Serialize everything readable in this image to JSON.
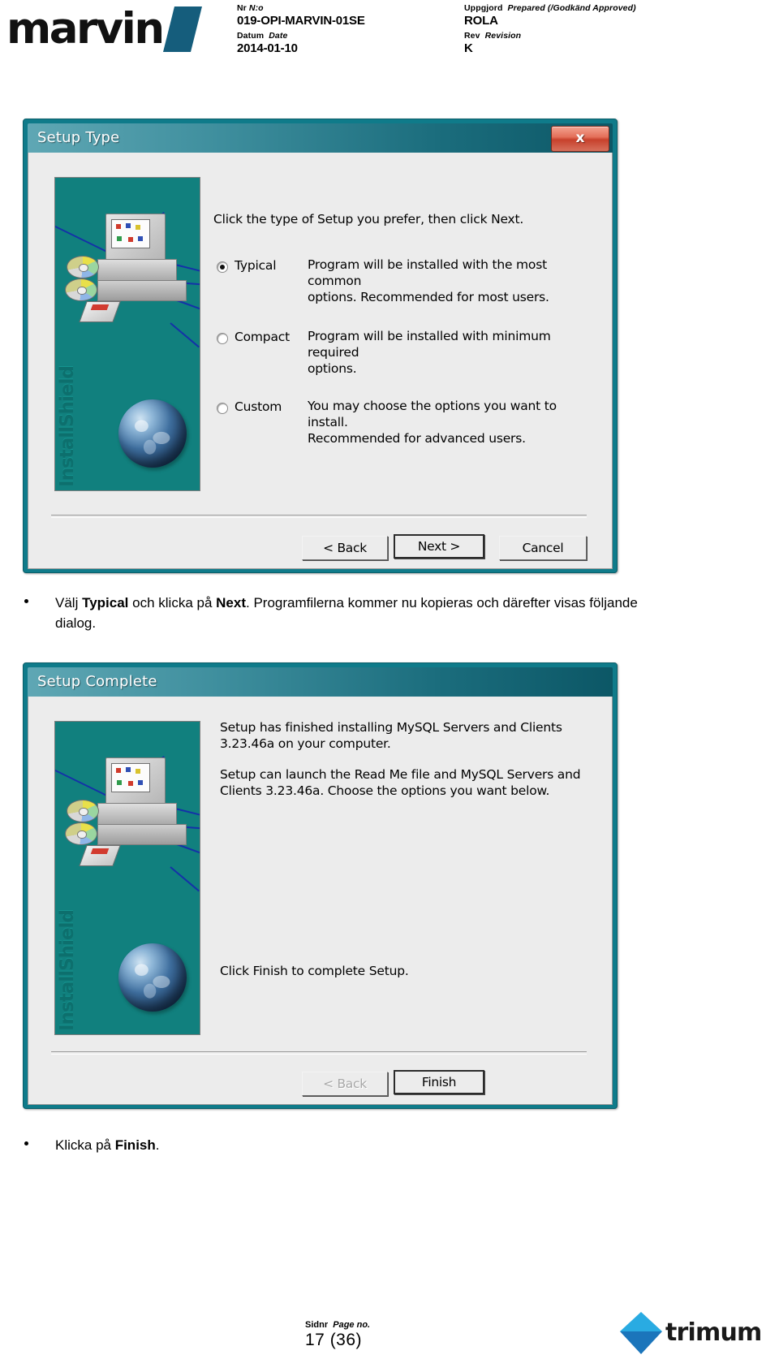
{
  "header": {
    "logo_text": "marvin",
    "fields": [
      {
        "label_sv": "Nr",
        "label_en": "N:o",
        "value": "019-OPI-MARVIN-01SE"
      },
      {
        "label_sv": "Datum",
        "label_en": "Date",
        "value": "2014-01-10"
      },
      {
        "label_sv": "Uppgjord",
        "label_en": "Prepared (/Godkänd Approved)",
        "value": "ROLA"
      },
      {
        "label_sv": "Rev",
        "label_en": "Revision",
        "value": "K"
      }
    ]
  },
  "dialog1": {
    "title": "Setup Type",
    "close_label": "x",
    "prompt": "Click the type of Setup you prefer, then click Next.",
    "options": [
      {
        "label": "Typical",
        "selected": true,
        "description": "Program will be installed with the most common\noptions.  Recommended for most users."
      },
      {
        "label": "Compact",
        "selected": false,
        "description": "Program will be installed with minimum required\noptions."
      },
      {
        "label": "Custom",
        "selected": false,
        "description": "You may choose the options you want to install.\nRecommended for advanced users."
      }
    ],
    "buttons": {
      "back": "< Back",
      "next": "Next >",
      "cancel": "Cancel"
    },
    "art_label": "InstallShield"
  },
  "note1": {
    "text_parts": [
      "Välj ",
      "Typical",
      " och klicka på ",
      "Next",
      ".  Programfilerna kommer nu kopieras och därefter visas följande dialog."
    ]
  },
  "dialog2": {
    "title": "Setup Complete",
    "paragraph1": "Setup has finished installing MySQL Servers and Clients\n3.23.46a on your computer.",
    "paragraph2": "Setup can launch the Read Me file and MySQL Servers and\nClients 3.23.46a.  Choose the options you want below.",
    "paragraph3": "Click Finish to complete Setup.",
    "buttons": {
      "back": "< Back",
      "finish": "Finish"
    },
    "art_label": "InstallShield"
  },
  "note2": {
    "text_parts": [
      "Klicka på ",
      "Finish",
      "."
    ]
  },
  "footer": {
    "page_label_sv": "Sidnr",
    "page_label_en": "Page no.",
    "page_value": "17 (36)",
    "company": "trimum"
  },
  "colors": {
    "accent_teal": "#0f7b8a",
    "installshield_teal": "#11807e",
    "marvin_blue": "#155d7c",
    "trimum_light": "#29abe2",
    "trimum_dark": "#1b75bb",
    "close_red": "#c7412c"
  }
}
